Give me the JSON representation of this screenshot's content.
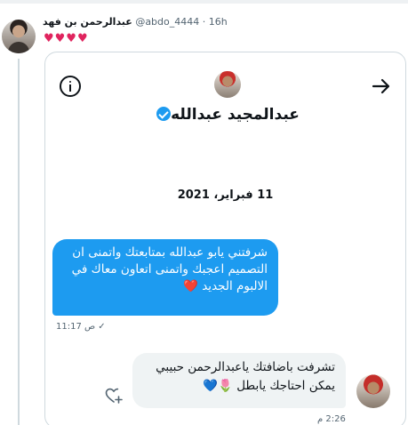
{
  "tweet": {
    "author_name": "عبدالرحمن بن فهد",
    "handle_time": "@abdo_4444 · 16h",
    "hearts": "♥♥♥♥"
  },
  "card": {
    "profile_name": "عبدالمجيد عبدالله",
    "date": "11 فبراير، 2021",
    "messages": [
      {
        "text": "شرفتني يابو عبدالله بمتابعتك واتمنى ان التصميم اعجبك واتمنى اتعاون معاك في الالبوم الجديد ❤️",
        "time": "11:17 ص",
        "status": "✓"
      },
      {
        "text": "تشرفت باضافتك ياعبدالرحمن حبيبي يمكن احتاجك يابطل 🌷💙",
        "time": "2:26 م"
      }
    ]
  },
  "colors": {
    "accent": "#1d9bf0",
    "heart": "#e0245e",
    "received_bubble": "#eff3f4"
  }
}
